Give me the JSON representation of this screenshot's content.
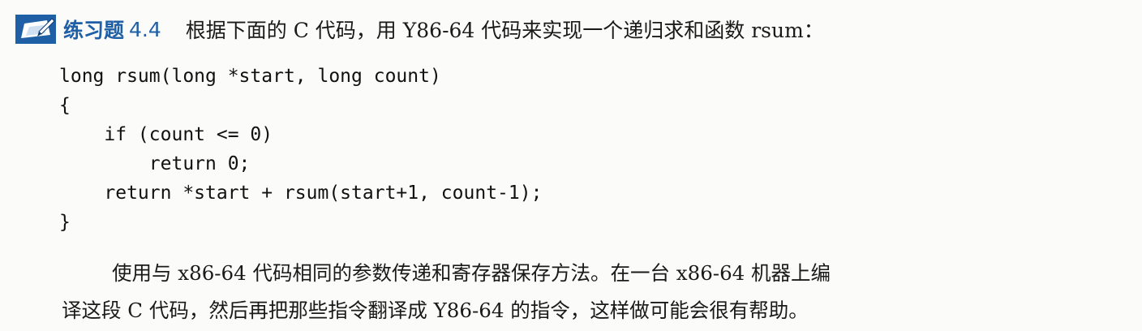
{
  "exercise": {
    "label": "练习题",
    "number": "4.4",
    "prompt": "根据下面的 C 代码，用 Y86-64 代码来实现一个递归求和函数 rsum："
  },
  "code_lines": [
    "long rsum(long *start, long count)",
    "{",
    "    if (count <= 0)",
    "        return 0;",
    "    return *start + rsum(start+1, count-1);",
    "}"
  ],
  "paragraph_lines": [
    "使用与 x86-64 代码相同的参数传递和寄存器保存方法。在一台 x86-64 机器上编",
    "译这段 C 代码，然后再把那些指令翻译成 Y86-64 的指令，这样做可能会很有帮助。"
  ]
}
